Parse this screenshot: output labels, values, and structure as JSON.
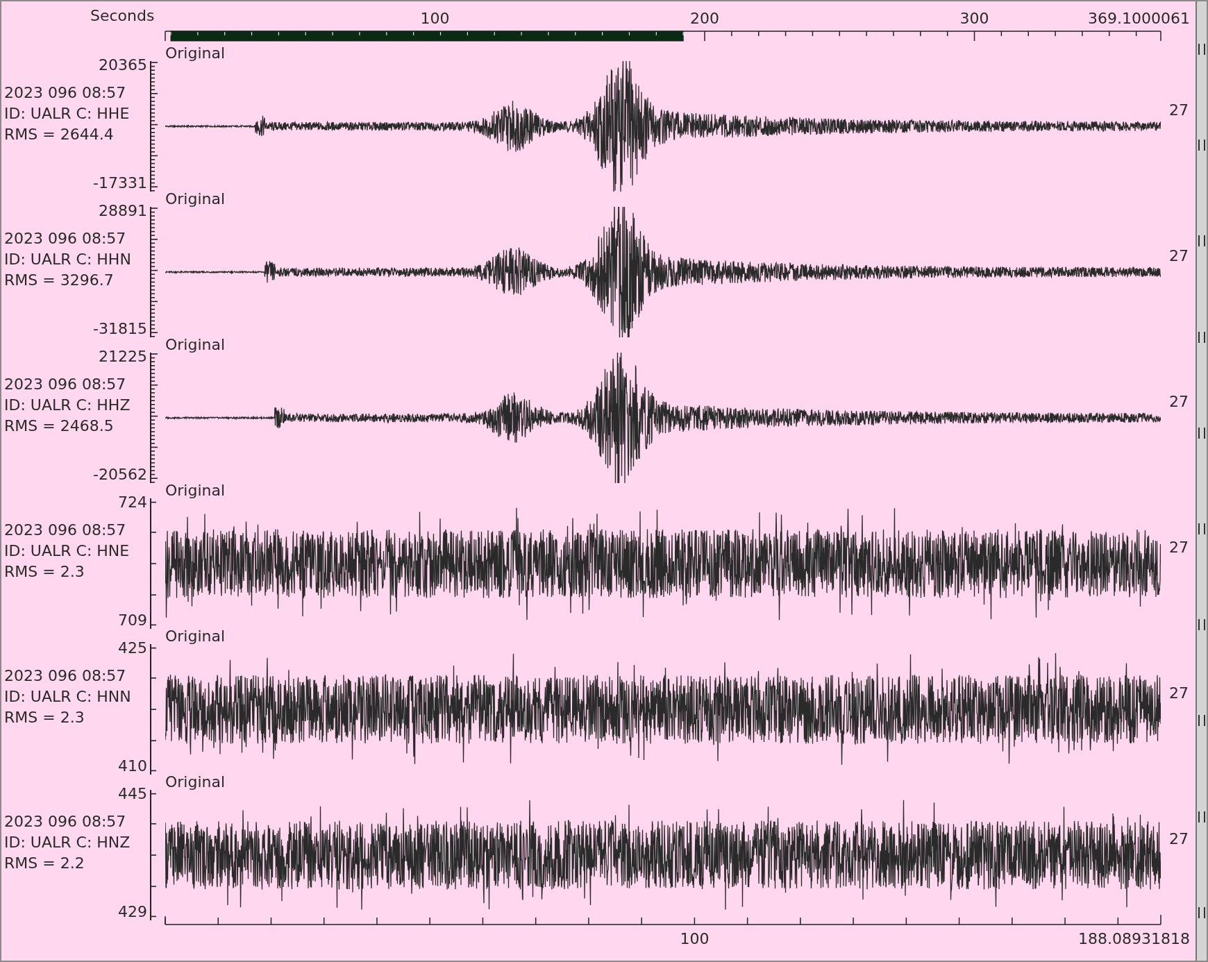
{
  "time_axis": {
    "title": "Seconds",
    "tick_labels": [
      "100",
      "200",
      "300"
    ],
    "end_label": "369.1000061"
  },
  "traces": [
    {
      "kind": "event",
      "filter": "Original",
      "max": "20365",
      "min": "-17331",
      "time": "2023 096 08:57",
      "id": "ID: UALR C: HHE",
      "rms": "RMS = 2644.4",
      "count": "27"
    },
    {
      "kind": "event",
      "filter": "Original",
      "max": "28891",
      "min": "-31815",
      "time": "2023 096 08:57",
      "id": "ID: UALR C: HHN",
      "rms": "RMS = 3296.7",
      "count": "27"
    },
    {
      "kind": "event",
      "filter": "Original",
      "max": "21225",
      "min": "-20562",
      "time": "2023 096 08:57",
      "id": "ID: UALR C: HHZ",
      "rms": "RMS = 2468.5",
      "count": "27"
    },
    {
      "kind": "noise",
      "filter": "Original",
      "max": "724",
      "min": "709",
      "time": "2023 096 08:57",
      "id": "ID: UALR C: HNE",
      "rms": "RMS = 2.3",
      "count": "27"
    },
    {
      "kind": "noise",
      "filter": "Original",
      "max": "425",
      "min": "410",
      "time": "2023 096 08:57",
      "id": "ID: UALR C: HNN",
      "rms": "RMS = 2.3",
      "count": "27"
    },
    {
      "kind": "noise",
      "filter": "Original",
      "max": "445",
      "min": "429",
      "time": "2023 096 08:57",
      "id": "ID: UALR C: HNZ",
      "rms": "RMS = 2.2",
      "count": "27"
    }
  ],
  "bottom_axis": {
    "tick_labels": [
      "100"
    ],
    "end_label": "188.08931818"
  }
}
